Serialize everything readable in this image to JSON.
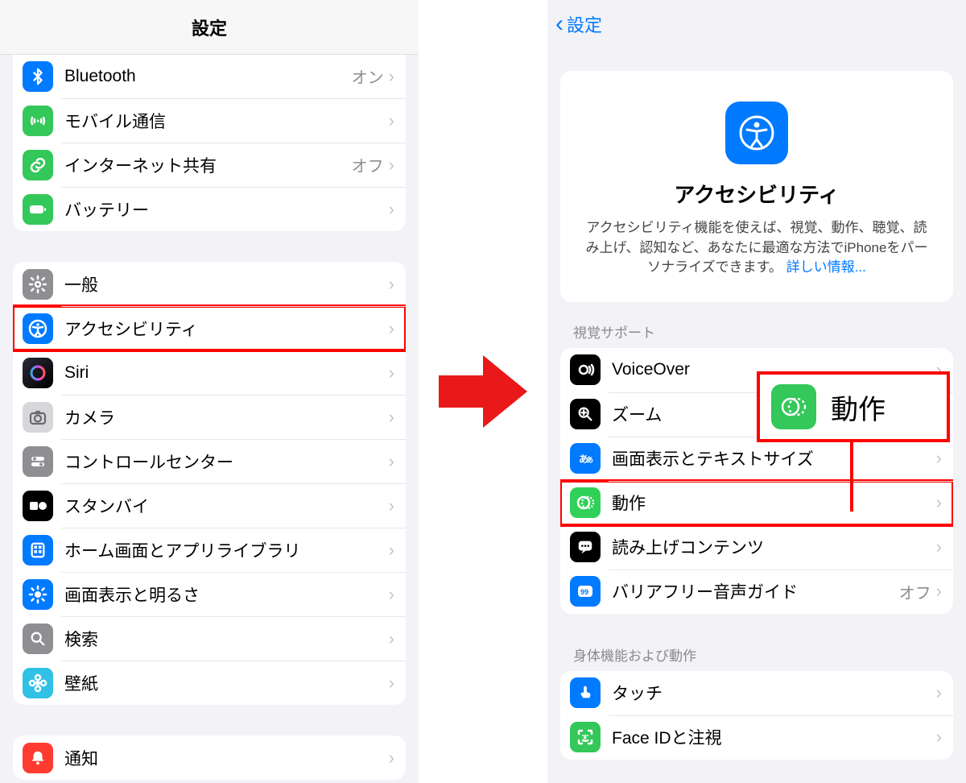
{
  "highlight_color": "#ff0000",
  "left": {
    "title": "設定",
    "group1": [
      {
        "icon": "bluetooth-icon",
        "bg": "bg-blue",
        "label": "Bluetooth",
        "value": "オン"
      },
      {
        "icon": "antenna-icon",
        "bg": "bg-green",
        "label": "モバイル通信",
        "value": ""
      },
      {
        "icon": "link-icon",
        "bg": "bg-green",
        "label": "インターネット共有",
        "value": "オフ"
      },
      {
        "icon": "battery-icon",
        "bg": "bg-green",
        "label": "バッテリー",
        "value": ""
      }
    ],
    "group2": [
      {
        "icon": "gear-icon",
        "bg": "bg-gray",
        "label": "一般",
        "hl": false
      },
      {
        "icon": "accessibility-icon",
        "bg": "bg-blue",
        "label": "アクセシビリティ",
        "hl": true
      },
      {
        "icon": "siri-icon",
        "bg": "bg-siri",
        "label": "Siri",
        "hl": false
      },
      {
        "icon": "camera-icon",
        "bg": "bg-graylt",
        "label": "カメラ",
        "hl": false
      },
      {
        "icon": "switches-icon",
        "bg": "bg-gray",
        "label": "コントロールセンター",
        "hl": false
      },
      {
        "icon": "standby-icon",
        "bg": "bg-black",
        "label": "スタンバイ",
        "hl": false
      },
      {
        "icon": "home-icon",
        "bg": "bg-blue",
        "label": "ホーム画面とアプリライブラリ",
        "hl": false
      },
      {
        "icon": "brightness-icon",
        "bg": "bg-blue",
        "label": "画面表示と明るさ",
        "hl": false
      },
      {
        "icon": "search-icon",
        "bg": "bg-gray",
        "label": "検索",
        "hl": false
      },
      {
        "icon": "wallpaper-icon",
        "bg": "bg-cyan",
        "label": "壁紙",
        "hl": false
      }
    ],
    "group3": [
      {
        "icon": "notifications-icon",
        "bg": "bg-red",
        "label": "通知"
      }
    ]
  },
  "right": {
    "back_label": "設定",
    "hero": {
      "title": "アクセシビリティ",
      "body": "アクセシビリティ機能を使えば、視覚、動作、聴覚、読み上げ、認知など、あなたに最適な方法でiPhoneをパーソナライズできます。",
      "link": "詳しい情報..."
    },
    "section1_header": "視覚サポート",
    "section1": [
      {
        "icon": "voiceover-icon",
        "bg": "bg-black",
        "label": "VoiceOver",
        "value": "",
        "hl": false
      },
      {
        "icon": "zoom-icon",
        "bg": "bg-black",
        "label": "ズーム",
        "value": "",
        "hl": false
      },
      {
        "icon": "textsize-icon",
        "bg": "bg-blue",
        "label": "画面表示とテキストサイズ",
        "value": "",
        "hl": false
      },
      {
        "icon": "motion-icon",
        "bg": "bg-green2",
        "label": "動作",
        "value": "",
        "hl": true
      },
      {
        "icon": "speech-icon",
        "bg": "bg-black",
        "label": "読み上げコンテンツ",
        "value": "",
        "hl": false
      },
      {
        "icon": "audio-desc-icon",
        "bg": "bg-blue",
        "label": "バリアフリー音声ガイド",
        "value": "オフ",
        "hl": false
      }
    ],
    "section2_header": "身体機能および動作",
    "section2": [
      {
        "icon": "touch-icon",
        "bg": "bg-blue",
        "label": "タッチ",
        "value": ""
      },
      {
        "icon": "faceid-icon",
        "bg": "bg-faceid",
        "label": "Face IDと注視",
        "value": ""
      }
    ],
    "callout_label": "動作"
  }
}
